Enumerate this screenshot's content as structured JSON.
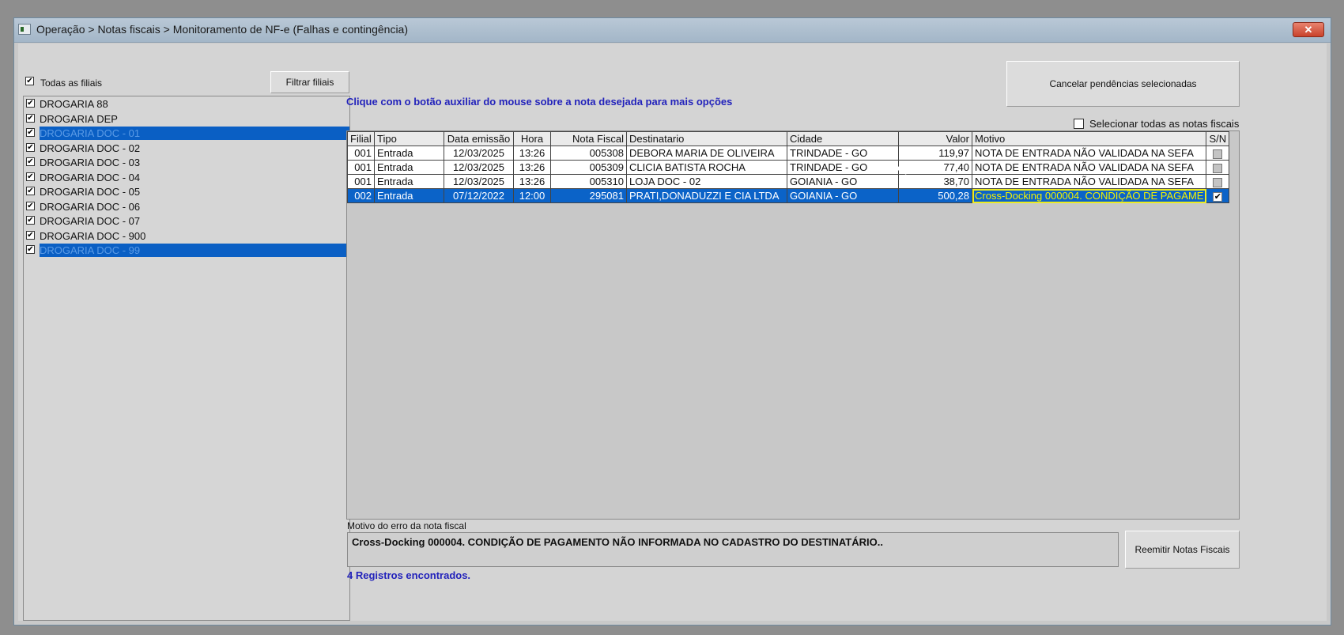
{
  "window": {
    "title": "Operação > Notas fiscais > Monitoramento de NF-e (Falhas e contingência)",
    "close_label": "✕"
  },
  "filiais": {
    "all_label": "Todas as filiais",
    "all_checked": true,
    "filter_button": "Filtrar filiais",
    "items": [
      {
        "label": "DROGARIA 88",
        "checked": true,
        "selected": false
      },
      {
        "label": "DROGARIA DEP",
        "checked": true,
        "selected": false
      },
      {
        "label": "DROGARIA DOC - 01",
        "checked": true,
        "selected": true
      },
      {
        "label": "DROGARIA DOC - 02",
        "checked": true,
        "selected": false
      },
      {
        "label": "DROGARIA DOC - 03",
        "checked": true,
        "selected": false
      },
      {
        "label": "DROGARIA DOC - 04",
        "checked": true,
        "selected": false
      },
      {
        "label": "DROGARIA DOC - 05",
        "checked": true,
        "selected": false
      },
      {
        "label": "DROGARIA DOC - 06",
        "checked": true,
        "selected": false
      },
      {
        "label": "DROGARIA DOC - 07",
        "checked": true,
        "selected": false
      },
      {
        "label": "DROGARIA DOC - 900",
        "checked": true,
        "selected": false
      },
      {
        "label": "DROGARIA DOC - 99",
        "checked": true,
        "selected": true
      }
    ]
  },
  "hint": "Clique com o botão auxiliar do mouse sobre a nota desejada para mais opções",
  "cancel_button": "Cancelar pendências selecionadas",
  "select_all_label": "Selecionar todas as notas fiscais",
  "table": {
    "columns": [
      "Filial",
      "Tipo",
      "Data emissão",
      "Hora",
      "Nota Fiscal",
      "Destinatario",
      "Cidade",
      "Valor",
      "Motivo",
      "S/N"
    ],
    "rows": [
      {
        "filial": "001",
        "tipo": "Entrada",
        "data": "12/03/2025",
        "hora": "13:26",
        "nota": "005308",
        "destinatario": "DEBORA  MARIA DE OLIVEIRA",
        "cidade": "TRINDADE - GO",
        "valor": "119,97",
        "motivo": "NOTA DE ENTRADA NÃO VALIDADA NA SEFA",
        "sn": false,
        "selected": false
      },
      {
        "filial": "001",
        "tipo": "Entrada",
        "data": "12/03/2025",
        "hora": "13:26",
        "nota": "005309",
        "destinatario": "CLICIA BATISTA ROCHA",
        "cidade": "TRINDADE - GO",
        "valor": "77,40",
        "motivo": "NOTA DE ENTRADA NÃO VALIDADA NA SEFA",
        "sn": false,
        "selected": false
      },
      {
        "filial": "001",
        "tipo": "Entrada",
        "data": "12/03/2025",
        "hora": "13:26",
        "nota": "005310",
        "destinatario": "LOJA DOC - 02",
        "cidade": "GOIANIA - GO",
        "valor": "38,70",
        "motivo": "NOTA DE ENTRADA NÃO VALIDADA NA SEFA",
        "sn": false,
        "selected": false
      },
      {
        "filial": "002",
        "tipo": "Entrada",
        "data": "07/12/2022",
        "hora": "12:00",
        "nota": "295081",
        "destinatario": "PRATI,DONADUZZI E CIA LTDA",
        "cidade": "GOIANIA - GO",
        "valor": "500,28",
        "motivo": "Cross-Docking 000004. CONDIÇÃO DE PAGAME",
        "sn": true,
        "selected": true
      }
    ]
  },
  "motivo_erro": {
    "label": "Motivo do erro da nota fiscal",
    "text": "Cross-Docking 000004. CONDIÇÃO DE PAGAMENTO NÃO INFORMADA NO CADASTRO DO DESTINATÁRIO.."
  },
  "reemitir_button": "Reemitir Notas Fiscais",
  "registros": "4 Registros encontrados."
}
